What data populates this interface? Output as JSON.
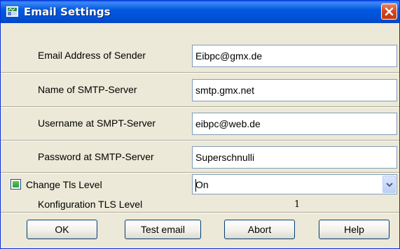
{
  "window": {
    "title": "Email Settings"
  },
  "fields": [
    {
      "label": "Email Address of Sender",
      "value": "Eibpc@gmx.de"
    },
    {
      "label": "Name of SMTP-Server",
      "value": "smtp.gmx.net"
    },
    {
      "label": "Username at SMPT-Server",
      "value": "eibpc@web.de"
    },
    {
      "label": "Password at SMTP-Server",
      "value": "Superschnulli"
    }
  ],
  "tls": {
    "checkbox_label": "Change Tls Level",
    "checked": true,
    "selected": "On",
    "config_label": "Konfiguration TLS Level",
    "config_value": "1"
  },
  "buttons": {
    "ok": "OK",
    "test": "Test email",
    "abort": "Abort",
    "help": "Help"
  },
  "icons": {
    "app": "app-window-icon",
    "close": "close-icon",
    "dropdown": "chevron-down-icon"
  },
  "colors": {
    "titlebar": "#0258e0",
    "close": "#d2451e",
    "checkbox_mark": "#2e9e2e",
    "dialog_bg": "#ece9d8"
  }
}
